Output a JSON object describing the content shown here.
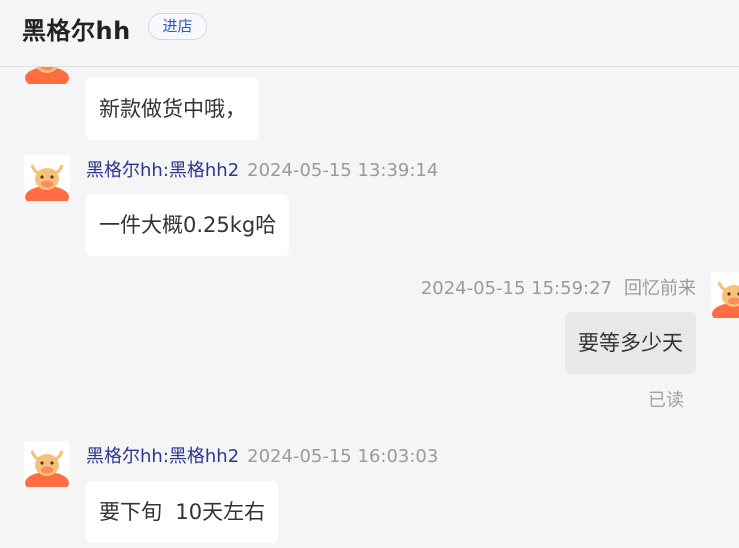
{
  "header": {
    "shop_name": "黑格尔hh",
    "enter_label": "进店"
  },
  "messages": [
    {
      "text": "新款做货中哦，"
    },
    {
      "sender": "黑格尔hh:黑格hh2",
      "time": "2024-05-15 13:39:14",
      "text": "一件大概0.25kg哈"
    },
    {
      "sender": "回忆前来",
      "time": "2024-05-15 15:59:27",
      "text": "要等多少天",
      "status": "已读"
    },
    {
      "sender": "黑格尔hh:黑格hh2",
      "time": "2024-05-15 16:03:03",
      "text": "要下旬  10天左右"
    }
  ],
  "colors": {
    "accent": "#2b59c3",
    "sender_name": "#2d3590",
    "avatar_orange": "#ff6e42"
  },
  "icons": [
    "cow-avatar-icon"
  ]
}
